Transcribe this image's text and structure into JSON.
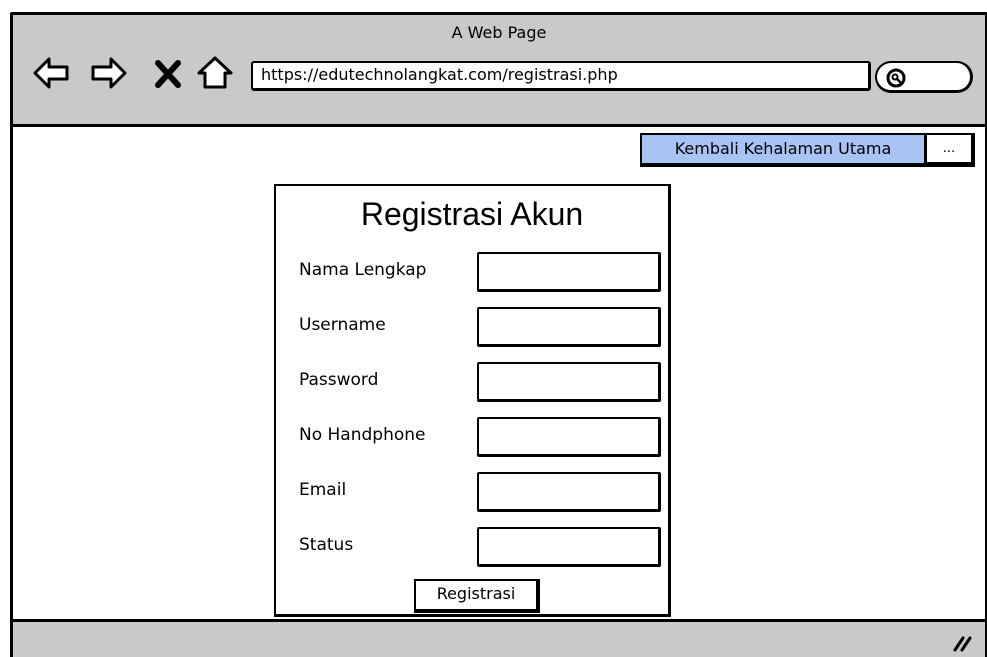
{
  "window": {
    "title": "A Web Page"
  },
  "browser": {
    "url": "https://edutechnolangkat.com/registrasi.php",
    "icons": [
      "back-arrow-icon",
      "forward-arrow-icon",
      "close-x-icon",
      "home-icon",
      "search-icon",
      "resize-grip-icon"
    ]
  },
  "toolbar": {
    "back_main_label": "Kembali Kehalaman Utama",
    "more_label": "..."
  },
  "form": {
    "title": "Registrasi Akun",
    "fields": [
      {
        "label": "Nama Lengkap",
        "value": ""
      },
      {
        "label": "Username",
        "value": ""
      },
      {
        "label": "Password",
        "value": ""
      },
      {
        "label": "No Handphone",
        "value": ""
      },
      {
        "label": "Email",
        "value": ""
      },
      {
        "label": "Status",
        "value": ""
      }
    ],
    "submit_label": "Registrasi"
  },
  "colors": {
    "chrome_gray": "#c9c9c9",
    "accent_blue": "#a7c4f5"
  }
}
